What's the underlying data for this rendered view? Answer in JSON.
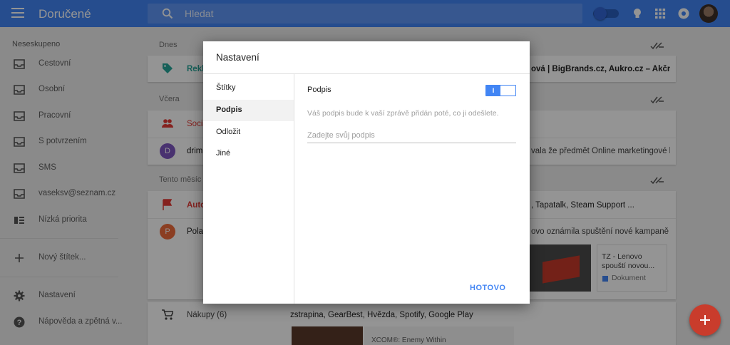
{
  "topbar": {
    "title": "Doručené",
    "search_placeholder": "Hledat",
    "icons": [
      "menu-icon",
      "search-icon",
      "pin-toggle",
      "bulb-icon",
      "apps-grid-icon",
      "notifications-icon",
      "user-avatar"
    ]
  },
  "sidebar": {
    "header": "Neseskupeno",
    "items": [
      {
        "label": "Cestovní",
        "icon": "inbox-icon"
      },
      {
        "label": "Osobní",
        "icon": "inbox-icon"
      },
      {
        "label": "Pracovní",
        "icon": "inbox-icon"
      },
      {
        "label": "S potvrzením",
        "icon": "inbox-icon"
      },
      {
        "label": "SMS",
        "icon": "inbox-icon"
      },
      {
        "label": "vaseksv@seznam.cz",
        "icon": "inbox-icon"
      },
      {
        "label": "Nízká priorita",
        "icon": "low-priority-icon"
      }
    ],
    "new_label": "Nový štítek...",
    "settings": "Nastavení",
    "help": "Nápověda a zpětná v..."
  },
  "inbox": {
    "sections": [
      "Dnes",
      "Včera",
      "Tento měsíc"
    ],
    "rows": [
      {
        "sender": "Rekl",
        "snippet": "ová | BigBrands.cz, Aukro.cz – Akční...",
        "color": "#26a69a"
      },
      {
        "sender": "Socia",
        "snippet": "",
        "color": "#e53935"
      },
      {
        "sender": "drimi",
        "snippet": "vala že předmět Online marketingové k...",
        "avatar": "D",
        "color": "#7e57c2"
      },
      {
        "sender": "Auto",
        "snippet": ", Tapatalk, Steam Support ...",
        "color": "#e53935"
      },
      {
        "sender": "Polac",
        "snippet": "ovo oznámila spuštění nové kampaně s ...",
        "avatar": "P",
        "color": "#ef6c3c"
      }
    ],
    "preview_card": {
      "title": "TZ - Lenovo spouští novou...",
      "doc": "Dokument"
    },
    "shopping": {
      "label": "Nákupy (6)",
      "snippet": "zstrapina, GearBest, Hvězda, Spotify, Google Play",
      "preview": "XCOM®: Enemy Within"
    }
  },
  "modal": {
    "title": "Nastavení",
    "nav": [
      "Štítky",
      "Podpis",
      "Odložit",
      "Jiné"
    ],
    "active_nav": "Podpis",
    "signature_label": "Podpis",
    "toggle_state": "I",
    "description": "Váš podpis bude k vaší zprávě přidán poté, co ji odešlete.",
    "input_placeholder": "Zadejte svůj podpis",
    "input_value": "",
    "done": "HOTOVO"
  },
  "colors": {
    "primary": "#4285f4",
    "fab": "#c93c2c",
    "overlay": "rgba(0,0,0,0.42)"
  }
}
